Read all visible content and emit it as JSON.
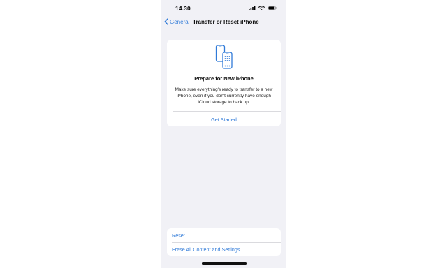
{
  "status_bar": {
    "time": "14.30",
    "icons": [
      "cellular-signal-icon",
      "wifi-icon",
      "battery-icon"
    ]
  },
  "nav": {
    "back_label": "General",
    "title": "Transfer or Reset iPhone"
  },
  "card": {
    "icon": "two-phones-icon",
    "title": "Prepare for New iPhone",
    "body": "Make sure everything's ready to transfer to a new iPhone, even if you don't currently have enough iCloud storage to back up.",
    "action_label": "Get Started"
  },
  "list": {
    "items": [
      {
        "label": "Reset"
      },
      {
        "label": "Erase All Content and Settings"
      }
    ]
  },
  "colors": {
    "accent": "#2f7ad8",
    "background": "#f1f1f6",
    "card": "#ffffff"
  }
}
